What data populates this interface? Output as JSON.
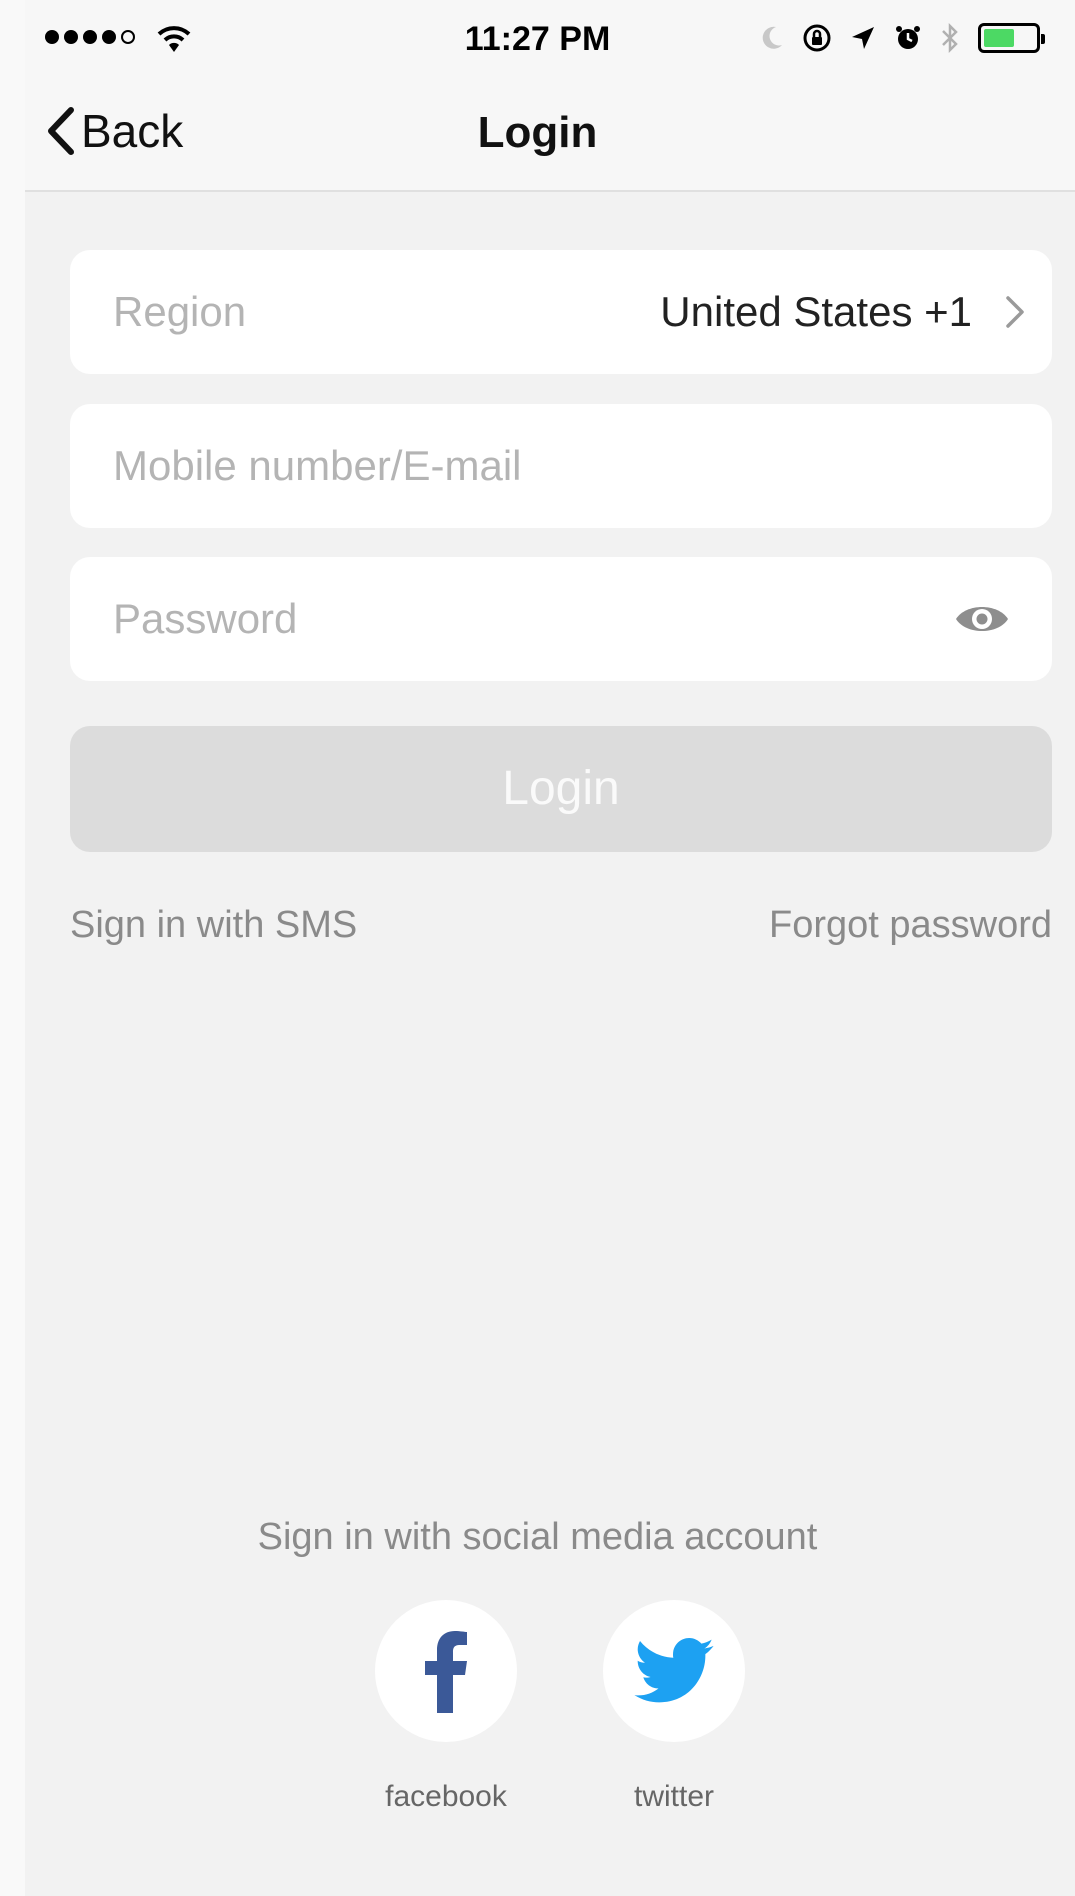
{
  "status_bar": {
    "time": "11:27 PM"
  },
  "nav": {
    "back_label": "Back",
    "title": "Login"
  },
  "form": {
    "region_label": "Region",
    "region_value": "United States +1",
    "account_placeholder": "Mobile number/E-mail",
    "password_placeholder": "Password",
    "login_label": "Login"
  },
  "links": {
    "sms": "Sign in with SMS",
    "forgot": "Forgot password"
  },
  "social": {
    "title": "Sign in with social media account",
    "facebook_label": "facebook",
    "twitter_label": "twitter"
  },
  "colors": {
    "background": "#f2f2f2",
    "field": "#ffffff",
    "button_disabled": "#dcdcdc",
    "facebook": "#3b5998",
    "twitter": "#1da1f2",
    "battery": "#4cd964"
  }
}
